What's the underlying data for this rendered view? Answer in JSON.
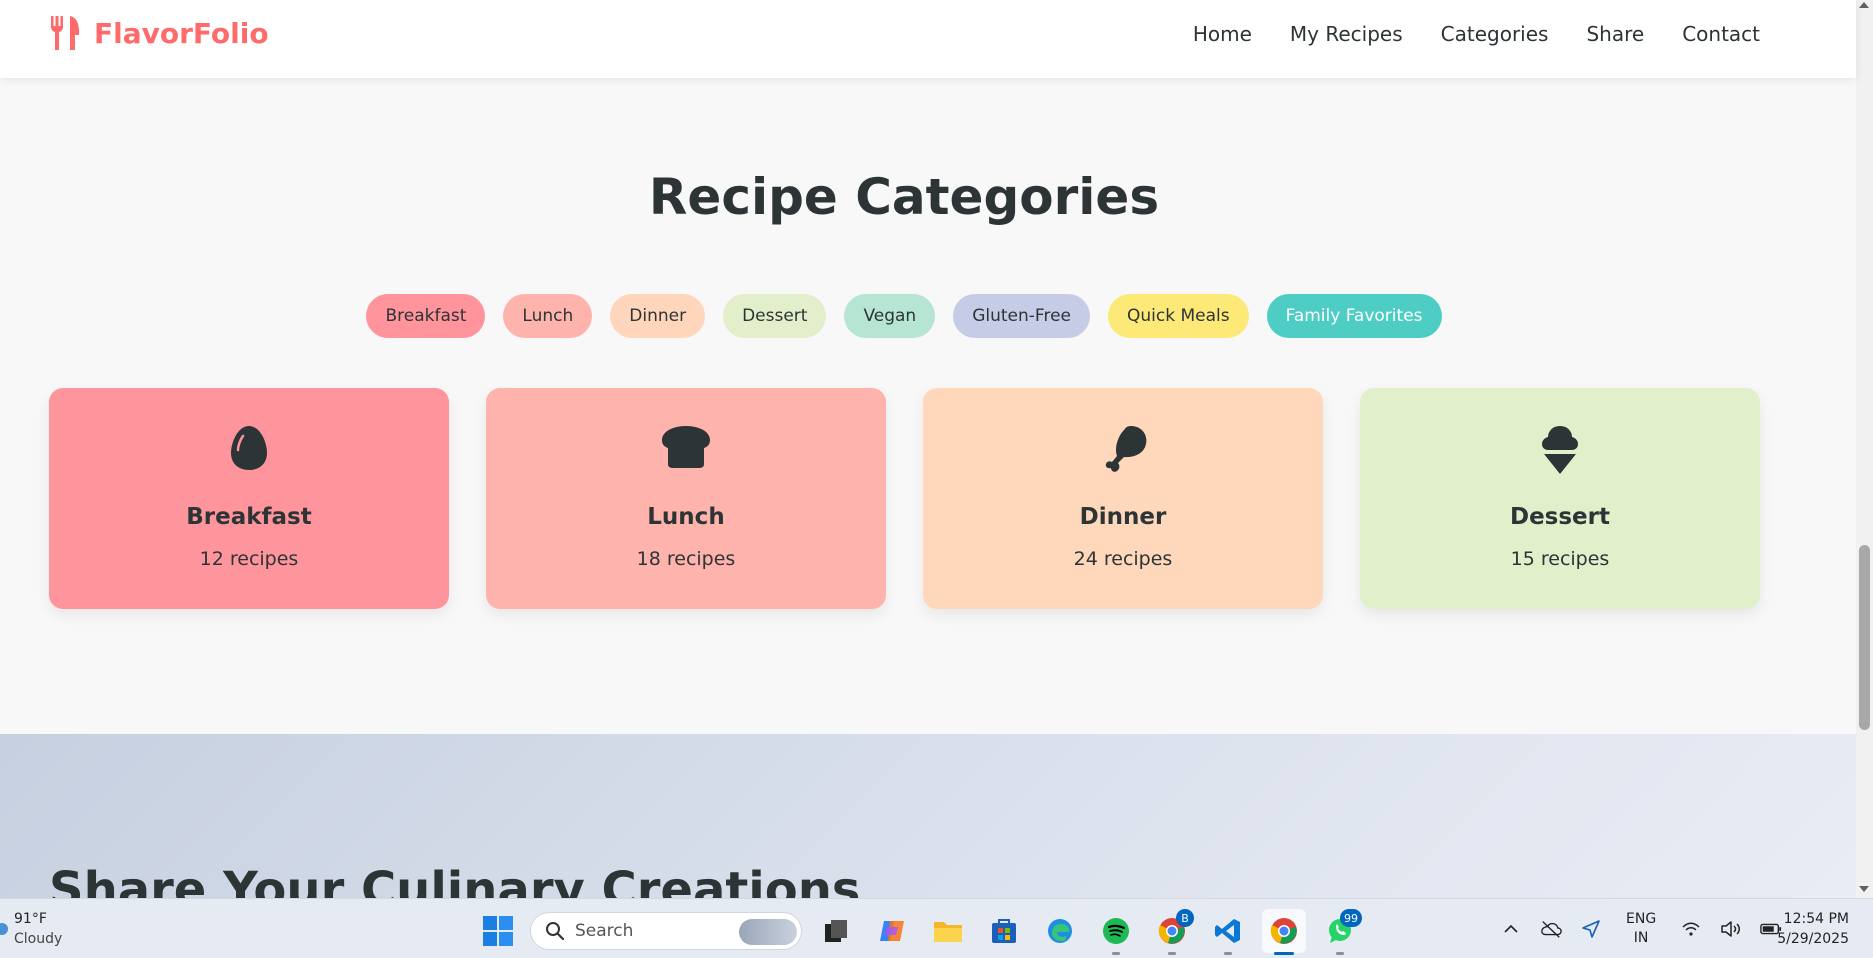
{
  "brand": {
    "name": "FlavorFolio",
    "color": "#ff6b6b",
    "icon": "utensils-icon"
  },
  "nav": {
    "items": [
      "Home",
      "My Recipes",
      "Categories",
      "Share",
      "Contact"
    ]
  },
  "categories_section": {
    "title": "Recipe Categories",
    "pills": [
      {
        "label": "Breakfast",
        "bg": "#ff949c",
        "color": "#2d3436"
      },
      {
        "label": "Lunch",
        "bg": "#ffb3ad",
        "color": "#2d3436"
      },
      {
        "label": "Dinner",
        "bg": "#ffd6bb",
        "color": "#2d3436"
      },
      {
        "label": "Dessert",
        "bg": "#e3efca",
        "color": "#2d3436"
      },
      {
        "label": "Vegan",
        "bg": "#b6e6d3",
        "color": "#2d3436"
      },
      {
        "label": "Gluten-Free",
        "bg": "#c7cce6",
        "color": "#2d3436"
      },
      {
        "label": "Quick Meals",
        "bg": "#fde978",
        "color": "#2d3436"
      },
      {
        "label": "Family Favorites",
        "bg": "#4ecdc4",
        "color": "#ffffff"
      }
    ],
    "cards": [
      {
        "title": "Breakfast",
        "count": "12 recipes",
        "bg": "#ff959c",
        "icon": "egg-icon"
      },
      {
        "title": "Lunch",
        "count": "18 recipes",
        "bg": "#ffb3ad",
        "icon": "bread-icon"
      },
      {
        "title": "Dinner",
        "count": "24 recipes",
        "bg": "#ffd7bb",
        "icon": "drumstick-icon"
      },
      {
        "title": "Dessert",
        "count": "15 recipes",
        "bg": "#e2efcb",
        "icon": "ice-cream-icon"
      }
    ]
  },
  "share_section": {
    "title": "Share Your Culinary Creations"
  },
  "taskbar": {
    "weather": {
      "temp": "91°F",
      "condition": "Cloudy"
    },
    "search_placeholder": "Search",
    "apps": [
      {
        "name": "task-view",
        "badge": "",
        "active": false,
        "open": false
      },
      {
        "name": "copilot",
        "badge": "",
        "active": false,
        "open": false
      },
      {
        "name": "file-explorer",
        "badge": "",
        "active": false,
        "open": false
      },
      {
        "name": "microsoft-store",
        "badge": "",
        "active": false,
        "open": false
      },
      {
        "name": "edge",
        "badge": "",
        "active": false,
        "open": false
      },
      {
        "name": "spotify",
        "badge": "",
        "active": false,
        "open": true
      },
      {
        "name": "chrome-profile",
        "badge": "B",
        "active": false,
        "open": true
      },
      {
        "name": "vscode",
        "badge": "",
        "active": false,
        "open": true
      },
      {
        "name": "chrome",
        "badge": "",
        "active": true,
        "open": true
      },
      {
        "name": "whatsapp",
        "badge": "99",
        "active": false,
        "open": true
      }
    ],
    "lang": {
      "line1": "ENG",
      "line2": "IN"
    },
    "time": "12:54 PM",
    "date": "5/29/2025"
  }
}
